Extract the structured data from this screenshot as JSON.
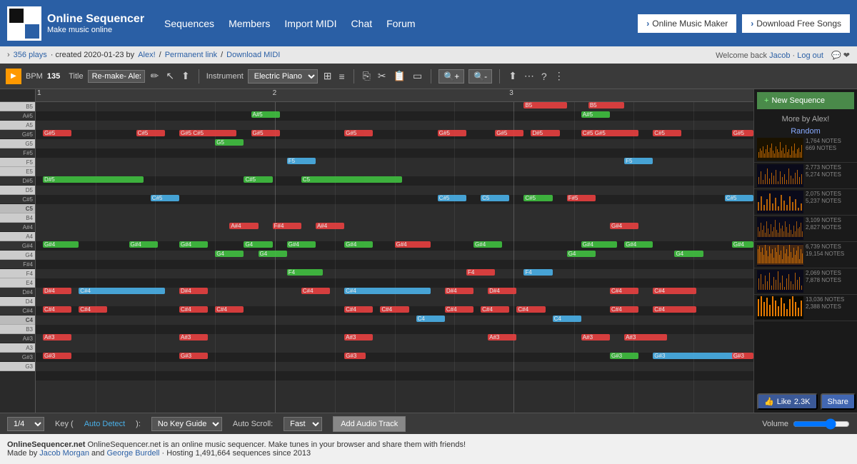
{
  "nav": {
    "logo_title": "Online Sequencer",
    "logo_sub": "Make music online",
    "links": [
      "Sequences",
      "Members",
      "Import MIDI",
      "Chat",
      "Forum"
    ],
    "btn_music_maker": "Online Music Maker",
    "btn_download": "Download Free Songs",
    "welcome": "Welcome back",
    "user": "Jacob",
    "logout": "Log out"
  },
  "sub_nav": {
    "plays": "356 plays",
    "created": "· created 2020-01-23 by",
    "author": "Alex!",
    "permanent_link": "Permanent link",
    "download_midi": "Download MIDI"
  },
  "toolbar": {
    "bpm_label": "BPM",
    "bpm_value": "135",
    "title_label": "Title",
    "title_value": "Re-make- Alex",
    "instrument_label": "Instrument",
    "instrument_value": "Electric Piano"
  },
  "bottom": {
    "division": "1/4",
    "key_label": "Key",
    "key_auto": "Auto Detect",
    "key_value": "No Key Guide",
    "scroll_label": "Auto Scroll:",
    "scroll_value": "Fast",
    "add_audio": "Add Audio Track",
    "volume_label": "Volume"
  },
  "footer": {
    "text1": "OnlineSequencer.net is an online music sequencer. Make tunes in your browser and share them with friends!",
    "text2": "Made by",
    "author1": "Jacob Morgan",
    "and": "and",
    "author2": "George Burdell",
    "hosting": "· Hosting 1,491,664 sequences since 2013"
  },
  "sidebar": {
    "new_sequence": "New Sequence",
    "more_by": "More by Alex!",
    "random": "Random",
    "thumbs": [
      {
        "notes1": "1,764 NOTES",
        "notes2": "669 NOTES"
      },
      {
        "notes1": "2,773 NOTES",
        "notes2": "5,274 NOTES"
      },
      {
        "notes1": "2,075 NOTES",
        "notes2": "5,237 NOTES"
      },
      {
        "notes1": "3,109 NOTES",
        "notes2": "2,827 NOTES"
      },
      {
        "notes1": "6,739 NOTES",
        "notes2": "19,154 NOTES"
      },
      {
        "notes1": "2,069 NOTES",
        "notes2": "7,878 NOTES"
      },
      {
        "notes1": "13,036 NOTES",
        "notes2": "2,388 NOTES"
      }
    ],
    "like_count": "2.3K",
    "like_label": "Like",
    "share_label": "Share"
  },
  "notes": [
    {
      "row": 0,
      "col": 0.05,
      "width": 0.6,
      "color": "#e84040",
      "label": "D#5"
    },
    {
      "row": 4,
      "col": 0.05,
      "width": 0.6,
      "color": "#e84040",
      "label": "G#5"
    },
    {
      "row": 14,
      "col": 0.05,
      "width": 1.8,
      "color": "#40c040",
      "label": "D#5"
    },
    {
      "row": 18,
      "col": 0.05,
      "width": 1.0,
      "color": "#40c040",
      "label": "G#4"
    },
    {
      "row": 22,
      "col": 0.05,
      "width": 0.6,
      "color": "#e84040",
      "label": "G#4"
    },
    {
      "row": 26,
      "col": 0.05,
      "width": 0.6,
      "color": "#40c040",
      "label": "G#4"
    },
    {
      "row": 28,
      "col": 0.05,
      "width": 0.6,
      "color": "#e84040",
      "label": "D#4"
    },
    {
      "row": 30,
      "col": 0.05,
      "width": 0.6,
      "color": "#4ab0e8",
      "label": "C#4"
    },
    {
      "row": 32,
      "col": 0.05,
      "width": 0.6,
      "color": "#e84040",
      "label": "C#4"
    },
    {
      "row": 36,
      "col": 0.05,
      "width": 0.6,
      "color": "#e84040",
      "label": "A#3"
    },
    {
      "row": 38,
      "col": 0.05,
      "width": 0.6,
      "color": "#e84040",
      "label": "G#3"
    }
  ],
  "measure_markers": [
    "1",
    "2",
    "3"
  ]
}
